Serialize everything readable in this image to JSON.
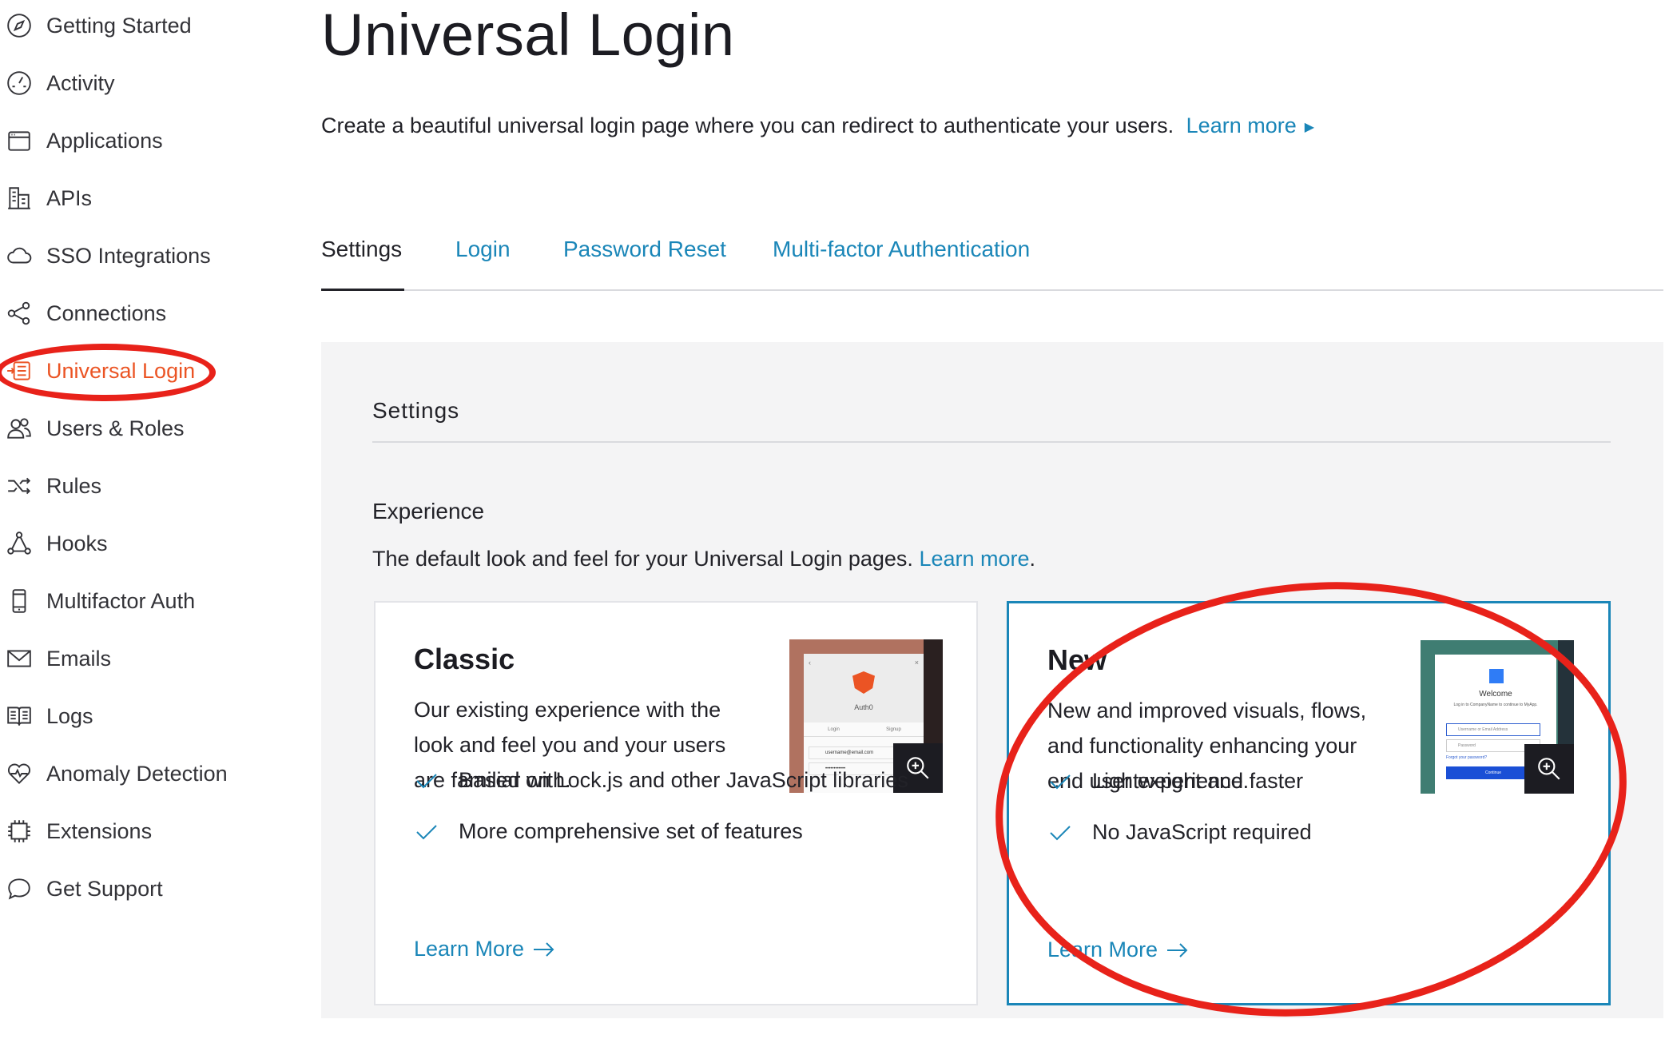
{
  "sidebar": {
    "items": [
      {
        "label": "Getting Started",
        "icon": "compass-icon"
      },
      {
        "label": "Activity",
        "icon": "gauge-icon"
      },
      {
        "label": "Applications",
        "icon": "window-icon"
      },
      {
        "label": "APIs",
        "icon": "building-icon"
      },
      {
        "label": "SSO Integrations",
        "icon": "cloud-icon"
      },
      {
        "label": "Connections",
        "icon": "share-icon"
      },
      {
        "label": "Universal Login",
        "icon": "login-page-icon"
      },
      {
        "label": "Users & Roles",
        "icon": "users-icon"
      },
      {
        "label": "Rules",
        "icon": "shuffle-icon"
      },
      {
        "label": "Hooks",
        "icon": "hook-nodes-icon"
      },
      {
        "label": "Multifactor Auth",
        "icon": "phone-icon"
      },
      {
        "label": "Emails",
        "icon": "envelope-icon"
      },
      {
        "label": "Logs",
        "icon": "book-icon"
      },
      {
        "label": "Anomaly Detection",
        "icon": "heart-pulse-icon"
      },
      {
        "label": "Extensions",
        "icon": "chip-icon"
      },
      {
        "label": "Get Support",
        "icon": "chat-bubble-icon"
      }
    ],
    "active_item": "Universal Login"
  },
  "header": {
    "title": "Universal Login",
    "description": "Create a beautiful universal login page where you can redirect to authenticate your users.",
    "learn_more": "Learn more"
  },
  "tabs": [
    {
      "label": "Settings",
      "active": true
    },
    {
      "label": "Login",
      "active": false
    },
    {
      "label": "Password Reset",
      "active": false
    },
    {
      "label": "Multi-factor Authentication",
      "active": false
    }
  ],
  "panel": {
    "heading": "Settings",
    "section_title": "Experience",
    "section_desc": "The default look and feel for your Universal Login pages.",
    "section_link": "Learn more",
    "section_period": "."
  },
  "cards": {
    "classic": {
      "title": "Classic",
      "description": "Our existing experience with the look and feel you and your users are familiar with.",
      "features": [
        "Based on Lock.js and other JavaScript libraries",
        "More comprehensive set of features"
      ],
      "learn_more": "Learn More",
      "thumb_brand": "Auth0",
      "thumb_tab_login": "Login",
      "thumb_tab_signup": "Signup",
      "thumb_user": "username@email.com",
      "thumb_pass": "••••••••••••",
      "selected": false
    },
    "new": {
      "title": "New",
      "description": "New and improved visuals, flows, and functionality enhancing your end user experience.",
      "features": [
        "Lightweight and faster",
        "No JavaScript required"
      ],
      "learn_more": "Learn More",
      "thumb_welcome": "Welcome",
      "thumb_sub": "Log in to CompanyName to continue to MyApp.",
      "thumb_email": "Username or Email Address",
      "thumb_password": "Password",
      "thumb_forgot": "Forgot your password?",
      "thumb_continue": "Continue",
      "selected": true
    }
  },
  "colors": {
    "link": "#1a86b8",
    "active_nav": "#eb5424",
    "annotation": "#e8221a",
    "panel_bg": "#f4f4f5"
  }
}
